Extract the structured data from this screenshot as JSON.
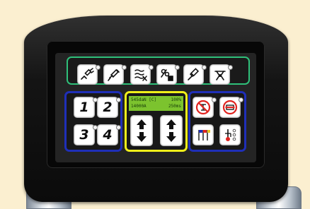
{
  "top_row": {
    "buttons": [
      {
        "icon": "pneumatic-wrench-icon"
      },
      {
        "icon": "lever-tool-icon"
      },
      {
        "icon": "adjust-arrows-icon"
      },
      {
        "icon": "blocking-tool-icon"
      },
      {
        "icon": "hammer-tool-icon"
      },
      {
        "icon": "caliper-icon"
      }
    ]
  },
  "keypad": {
    "keys": [
      "1",
      "2",
      "3",
      "4"
    ]
  },
  "display": {
    "line1_left": "545daN [C]",
    "line1_right": "100%",
    "line2_left": "14000A",
    "line2_right": "250ms"
  },
  "arrows": {
    "buttons": [
      {
        "icon": "up-down-arrows-icon"
      },
      {
        "icon": "up-down-arrows-icon"
      }
    ]
  },
  "right_group": {
    "buttons": [
      {
        "icon": "no-gun-icon"
      },
      {
        "icon": "no-welding-icon"
      },
      {
        "icon": "flags-icon"
      },
      {
        "icon": "temperature-icon"
      }
    ]
  },
  "colors": {
    "background": "#fbefd0",
    "top_group_border": "#2fc07a",
    "side_group_border": "#1f2fb8",
    "middle_group_border": "#f0ef1a",
    "lcd_background": "#7cc32e",
    "prohibition_red": "#e0231f"
  }
}
